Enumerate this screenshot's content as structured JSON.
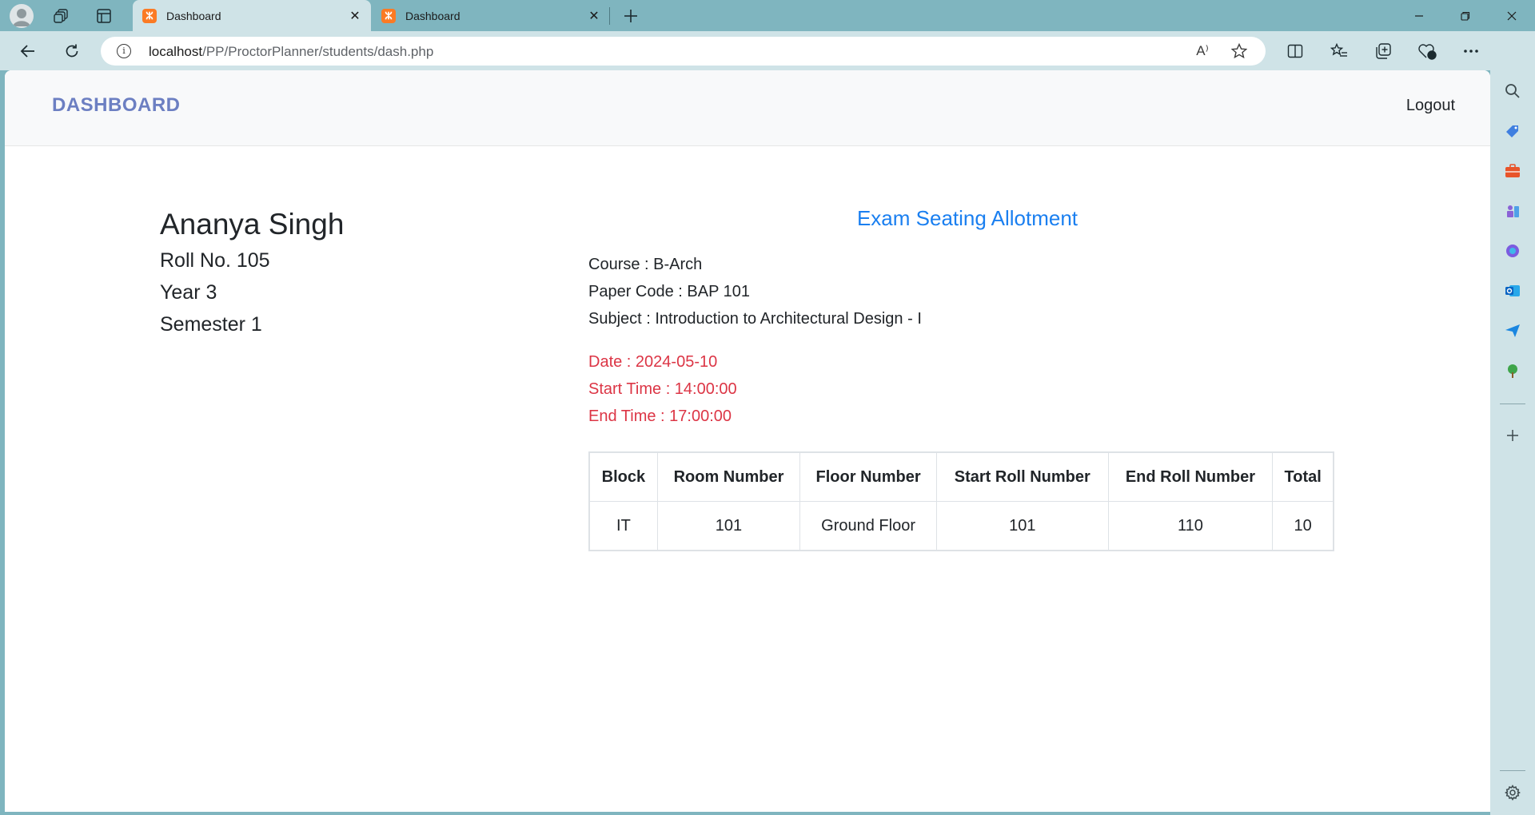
{
  "browser": {
    "tabs": [
      {
        "title": "Dashboard",
        "active": true
      },
      {
        "title": "Dashboard",
        "active": false
      }
    ],
    "url_host": "localhost",
    "url_path": "/PP/ProctorPlanner/students/dash.php",
    "read_aloud_label": "A⁾"
  },
  "navbar": {
    "brand": "DASHBOARD",
    "logout_label": "Logout"
  },
  "student": {
    "name": "Ananya Singh",
    "roll": "Roll No. 105",
    "year": "Year 3",
    "semester": "Semester 1"
  },
  "exam": {
    "title": "Exam Seating Allotment",
    "course": "Course : B-Arch",
    "paper_code": "Paper Code : BAP 101",
    "subject": "Subject : Introduction to Architectural Design - I",
    "date": "Date : 2024-05-10",
    "start_time": "Start Time : 14:00:00",
    "end_time": "End Time : 17:00:00"
  },
  "table": {
    "headers": [
      "Block",
      "Room Number",
      "Floor Number",
      "Start Roll Number",
      "End Roll Number",
      "Total"
    ],
    "rows": [
      [
        "IT",
        "101",
        "Ground Floor",
        "101",
        "110",
        "10"
      ]
    ]
  },
  "colors": {
    "brand": "#6c7fc2",
    "section_title": "#1a7ff0",
    "alert_text": "#dc3545",
    "chrome": "#cfe3e7",
    "titlebar": "#7fb5bf"
  },
  "icons": {
    "tab_favicon": "xampp-icon"
  }
}
